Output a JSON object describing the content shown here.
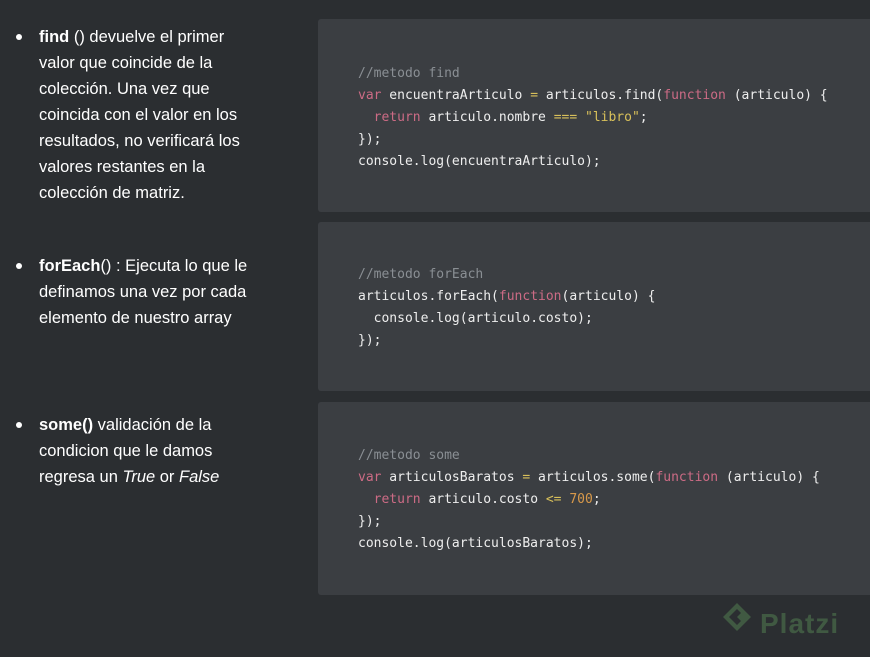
{
  "sections": [
    {
      "term": "find",
      "description_lines": [
        " () devuelve el primer",
        "valor que coincide de la",
        "colección. Una vez que",
        "coincida con el valor en los",
        "resultados, no verificará los",
        "valores restantes en la",
        "colección de matriz."
      ],
      "code": {
        "comment": "//metodo find",
        "line2": {
          "kw": "var",
          "name": " encuentraArticulo ",
          "op": "=",
          "call": " articulos.find(",
          "fn": "function",
          "args": " (articulo) {"
        },
        "line3": {
          "kw": "return",
          "expr": " articulo.nombre ",
          "op": "===",
          "str": "\"libro\"",
          "end": ";"
        },
        "line4": "});",
        "line5": "console.log(encuentraArticulo);"
      }
    },
    {
      "term": "forEach",
      "description_lines": [
        "() : Ejecuta lo que le",
        "definamos una vez por cada",
        "elemento de nuestro array"
      ],
      "code": {
        "comment": "//metodo forEach",
        "line2": {
          "call": "articulos.forEach(",
          "fn": "function",
          "args": "(articulo) {"
        },
        "line3": "console.log(articulo.costo);",
        "line4": "});"
      }
    },
    {
      "term": "some()",
      "description_lines": [
        " validación de la",
        "condicion que le damos",
        "regresa un "
      ],
      "true_word": "True",
      "or_word": " or ",
      "false_word": "False",
      "code": {
        "comment": "//metodo some",
        "line2": {
          "kw": "var",
          "name": " articulosBaratos ",
          "op": "=",
          "call": " articulos.some(",
          "fn": "function",
          "args": " (articulo) {"
        },
        "line3": {
          "kw": "return",
          "expr": " articulo.costo ",
          "op": "<=",
          "num": "700",
          "end": ";"
        },
        "line4": "});",
        "line5": "console.log(articulosBaratos);"
      }
    }
  ],
  "watermark": {
    "text": "Platzi",
    "icon": "platzi-logo-icon"
  },
  "colors": {
    "background": "#2b2e31",
    "code_background": "#3b3e42",
    "keyword": "#cc6b85",
    "string": "#d8c05a",
    "number": "#d8994a",
    "comment": "#8a8f94"
  }
}
